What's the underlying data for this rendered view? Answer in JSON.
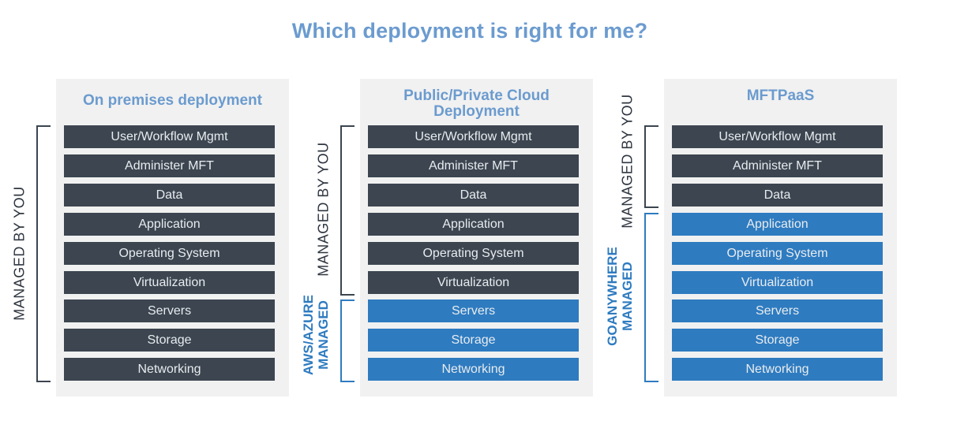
{
  "title": "Which deployment is right for me?",
  "colors": {
    "title": "#6b9bcf",
    "managed_by_you": "#3c4550",
    "vendor_managed": "#2e7bc0",
    "panel_bg": "#f1f1f1"
  },
  "panels": [
    {
      "title": "On premises deployment",
      "layers": [
        {
          "label": "User/Workflow Mgmt",
          "managed_by": "you"
        },
        {
          "label": "Administer MFT",
          "managed_by": "you"
        },
        {
          "label": "Data",
          "managed_by": "you"
        },
        {
          "label": "Application",
          "managed_by": "you"
        },
        {
          "label": "Operating System",
          "managed_by": "you"
        },
        {
          "label": "Virtualization",
          "managed_by": "you"
        },
        {
          "label": "Servers",
          "managed_by": "you"
        },
        {
          "label": "Storage",
          "managed_by": "you"
        },
        {
          "label": "Networking",
          "managed_by": "you"
        }
      ],
      "brackets": [
        {
          "label": "MANAGED BY YOU",
          "line1": "MANAGED BY YOU",
          "line2": "",
          "from_layer": 0,
          "to_layer": 8
        }
      ]
    },
    {
      "title_line1": "Public/Private Cloud",
      "title_line2": "Deployment",
      "title": "Public/Private Cloud Deployment",
      "layers": [
        {
          "label": "User/Workflow Mgmt",
          "managed_by": "you"
        },
        {
          "label": "Administer MFT",
          "managed_by": "you"
        },
        {
          "label": "Data",
          "managed_by": "you"
        },
        {
          "label": "Application",
          "managed_by": "you"
        },
        {
          "label": "Operating System",
          "managed_by": "you"
        },
        {
          "label": "Virtualization",
          "managed_by": "you"
        },
        {
          "label": "Servers",
          "managed_by": "vendor"
        },
        {
          "label": "Storage",
          "managed_by": "vendor"
        },
        {
          "label": "Networking",
          "managed_by": "vendor"
        }
      ],
      "brackets": [
        {
          "label": "MANAGED BY YOU",
          "line1": "MANAGED BY YOU",
          "line2": "",
          "from_layer": 0,
          "to_layer": 5
        },
        {
          "label": "AWS/AZURE MANAGED",
          "line1": "AWS/AZURE",
          "line2": "MANAGED",
          "from_layer": 6,
          "to_layer": 8
        }
      ]
    },
    {
      "title": "MFTPaaS",
      "layers": [
        {
          "label": "User/Workflow Mgmt",
          "managed_by": "you"
        },
        {
          "label": "Administer MFT",
          "managed_by": "you"
        },
        {
          "label": "Data",
          "managed_by": "you"
        },
        {
          "label": "Application",
          "managed_by": "vendor"
        },
        {
          "label": "Operating System",
          "managed_by": "vendor"
        },
        {
          "label": "Virtualization",
          "managed_by": "vendor"
        },
        {
          "label": "Servers",
          "managed_by": "vendor"
        },
        {
          "label": "Storage",
          "managed_by": "vendor"
        },
        {
          "label": "Networking",
          "managed_by": "vendor"
        }
      ],
      "brackets": [
        {
          "label": "MANAGED BY YOU",
          "line1": "MANAGED BY YOU",
          "line2": "",
          "from_layer": 0,
          "to_layer": 2
        },
        {
          "label": "GOANYWHERE MANAGED",
          "line1": "GOANYWHERE",
          "line2": "MANAGED",
          "from_layer": 3,
          "to_layer": 8
        }
      ]
    }
  ]
}
